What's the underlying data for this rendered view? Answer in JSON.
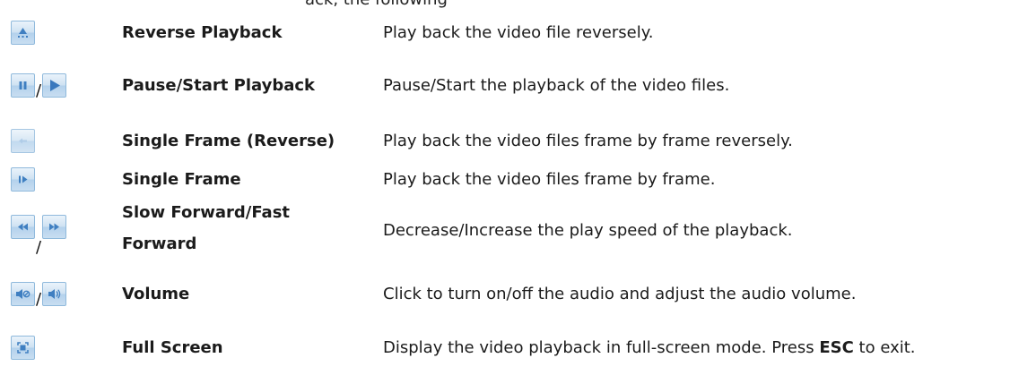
{
  "cut_text": "ack, the following",
  "rows": [
    {
      "name": "Reverse Playback",
      "description": "Play back the video file reversely.",
      "icons": [
        "reverse-playback-icon"
      ]
    },
    {
      "name": "Pause/Start Playback",
      "description": "Pause/Start the playback of the video files.",
      "icons": [
        "pause-icon",
        "play-icon"
      ],
      "separator": "/"
    },
    {
      "name": "Single Frame (Reverse)",
      "description": "Play back the video files frame by frame reversely.",
      "icons": [
        "single-frame-reverse-icon"
      ]
    },
    {
      "name": "Single Frame",
      "description": "Play back the video files frame by frame.",
      "icons": [
        "single-frame-icon"
      ]
    },
    {
      "name_line1": "Slow Forward/Fast",
      "name_line2": "Forward",
      "description": "Decrease/Increase the play speed of the playback.",
      "icons": [
        "slow-forward-icon",
        "fast-forward-icon"
      ],
      "separator": "/"
    },
    {
      "name": "Volume",
      "description": "Click to turn on/off the audio and adjust the audio volume.",
      "icons": [
        "audio-off-icon",
        "audio-on-icon"
      ],
      "separator": "/"
    },
    {
      "name": "Full Screen",
      "description_before": "Display the video playback in full-screen mode. Press ",
      "description_key": "ESC",
      "description_after": " to exit.",
      "icons": [
        "full-screen-icon"
      ]
    }
  ],
  "colors": {
    "icon_glyph": "#3f7fc1",
    "icon_border": "#8fb9dc",
    "text": "#1b1b1b"
  }
}
